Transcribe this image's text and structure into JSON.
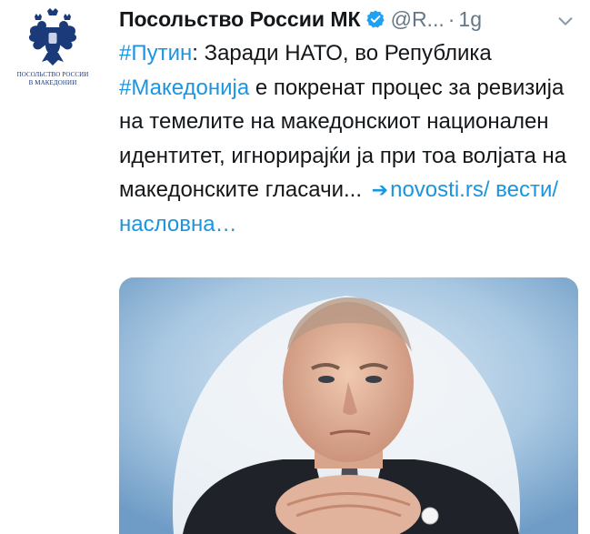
{
  "avatar": {
    "caption_line1": "ПОСОЛЬСТВО РОССИИ",
    "caption_line2": "В МАКЕДОНИИ",
    "icon": "double-headed-eagle-emblem"
  },
  "header": {
    "display_name": "Посольство России МК",
    "handle": "@R...",
    "separator": "·",
    "timestamp": "1g",
    "verified_icon": "verified-badge-icon",
    "more_icon": "chevron-down-icon"
  },
  "tweet": {
    "hashtag1": "#Путин",
    "text1": ": Заради НАТО, во Република",
    "hashtag2": "#Македонија",
    "text2": " е покренат процес за ревизија на темелите на македонскиот национален идентитет, игнорирајќи ја при тоа волјата на македонските гласачи...",
    "arrow": "➔",
    "link": "novosti.rs/ вести/насловна…"
  },
  "media": {
    "description_icon": "tweet-photo"
  },
  "colors": {
    "link": "#1b95e0",
    "text": "#14171a",
    "muted": "#657786",
    "emblem": "#1a3a7a"
  }
}
